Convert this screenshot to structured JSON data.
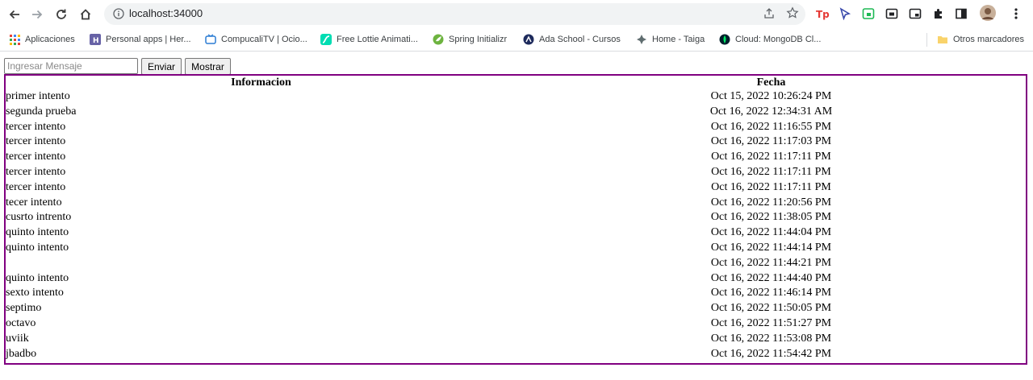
{
  "browser": {
    "url": "localhost:34000",
    "bookmarks": [
      {
        "label": "Aplicaciones",
        "icon": "apps-grid-icon"
      },
      {
        "label": "Personal apps | Her...",
        "icon": "heroku-icon"
      },
      {
        "label": "CompucaliTV | Ocio...",
        "icon": "tv-icon"
      },
      {
        "label": "Free Lottie Animati...",
        "icon": "lottie-icon"
      },
      {
        "label": "Spring Initializr",
        "icon": "spring-icon"
      },
      {
        "label": "Ada School - Cursos",
        "icon": "ada-school-icon"
      },
      {
        "label": "Home - Taiga",
        "icon": "taiga-icon"
      },
      {
        "label": "Cloud: MongoDB Cl...",
        "icon": "mongodb-icon"
      }
    ],
    "other_bookmarks": "Otros marcadores"
  },
  "form": {
    "input_placeholder": "Ingresar Mensaje",
    "input_value": "",
    "send_label": "Enviar",
    "show_label": "Mostrar"
  },
  "table": {
    "headers": {
      "info": "Informacion",
      "date": "Fecha"
    },
    "rows": [
      {
        "info": "primer intento",
        "date": "Oct 15, 2022 10:26:24 PM"
      },
      {
        "info": "segunda prueba",
        "date": "Oct 16, 2022 12:34:31 AM"
      },
      {
        "info": "tercer intento",
        "date": "Oct 16, 2022 11:16:55 PM"
      },
      {
        "info": "tercer intento",
        "date": "Oct 16, 2022 11:17:03 PM"
      },
      {
        "info": "tercer intento",
        "date": "Oct 16, 2022 11:17:11 PM"
      },
      {
        "info": "tercer intento",
        "date": "Oct 16, 2022 11:17:11 PM"
      },
      {
        "info": "tercer intento",
        "date": "Oct 16, 2022 11:17:11 PM"
      },
      {
        "info": "tecer intento",
        "date": "Oct 16, 2022 11:20:56 PM"
      },
      {
        "info": "cusrto intrento",
        "date": "Oct 16, 2022 11:38:05 PM"
      },
      {
        "info": "quinto intento",
        "date": "Oct 16, 2022 11:44:04 PM"
      },
      {
        "info": "quinto intento",
        "date": "Oct 16, 2022 11:44:14 PM"
      },
      {
        "info": "",
        "date": "Oct 16, 2022 11:44:21 PM"
      },
      {
        "info": "quinto intento",
        "date": "Oct 16, 2022 11:44:40 PM"
      },
      {
        "info": "sexto intento",
        "date": "Oct 16, 2022 11:46:14 PM"
      },
      {
        "info": "septimo",
        "date": "Oct 16, 2022 11:50:05 PM"
      },
      {
        "info": "octavo",
        "date": "Oct 16, 2022 11:51:27 PM"
      },
      {
        "info": "uviik",
        "date": "Oct 16, 2022 11:53:08 PM"
      },
      {
        "info": "jbadbo",
        "date": "Oct 16, 2022 11:54:42 PM"
      }
    ]
  },
  "colors": {
    "table_border": "#800080",
    "omnibox_bg": "#f1f3f4"
  }
}
